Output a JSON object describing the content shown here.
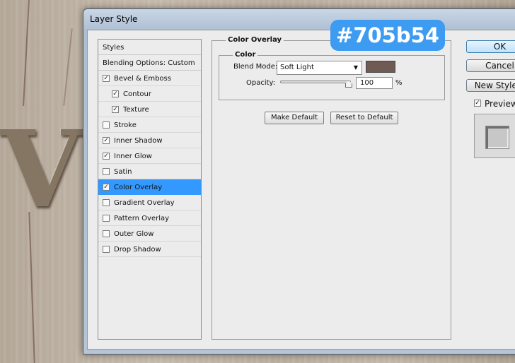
{
  "dialog": {
    "title": "Layer Style"
  },
  "styles_panel": {
    "header": "Styles",
    "blending_options": "Blending Options: Custom",
    "items": [
      {
        "label": "Bevel & Emboss",
        "checked": true,
        "indent": false,
        "selected": false
      },
      {
        "label": "Contour",
        "checked": true,
        "indent": true,
        "selected": false
      },
      {
        "label": "Texture",
        "checked": true,
        "indent": true,
        "selected": false
      },
      {
        "label": "Stroke",
        "checked": false,
        "indent": false,
        "selected": false
      },
      {
        "label": "Inner Shadow",
        "checked": true,
        "indent": false,
        "selected": false
      },
      {
        "label": "Inner Glow",
        "checked": true,
        "indent": false,
        "selected": false
      },
      {
        "label": "Satin",
        "checked": false,
        "indent": false,
        "selected": false
      },
      {
        "label": "Color Overlay",
        "checked": true,
        "indent": false,
        "selected": true
      },
      {
        "label": "Gradient Overlay",
        "checked": false,
        "indent": false,
        "selected": false
      },
      {
        "label": "Pattern Overlay",
        "checked": false,
        "indent": false,
        "selected": false
      },
      {
        "label": "Outer Glow",
        "checked": false,
        "indent": false,
        "selected": false
      },
      {
        "label": "Drop Shadow",
        "checked": false,
        "indent": false,
        "selected": false
      }
    ]
  },
  "color_overlay": {
    "group_title": "Color Overlay",
    "subgroup_title": "Color",
    "blend_mode_label": "Blend Mode:",
    "blend_mode_value": "Soft Light",
    "swatch_color": "#705b54",
    "opacity_label": "Opacity:",
    "opacity_value": "100",
    "opacity_unit": "%",
    "opacity_level_percent": 100,
    "make_default": "Make Default",
    "reset_to_default": "Reset to Default"
  },
  "buttons": {
    "ok": "OK",
    "cancel": "Cancel",
    "new_style": "New Style...",
    "preview_label": "Preview",
    "preview_checked": true
  },
  "badge": {
    "text": "#705b54",
    "color": "#3d9bf2"
  },
  "checkmark": "✓"
}
